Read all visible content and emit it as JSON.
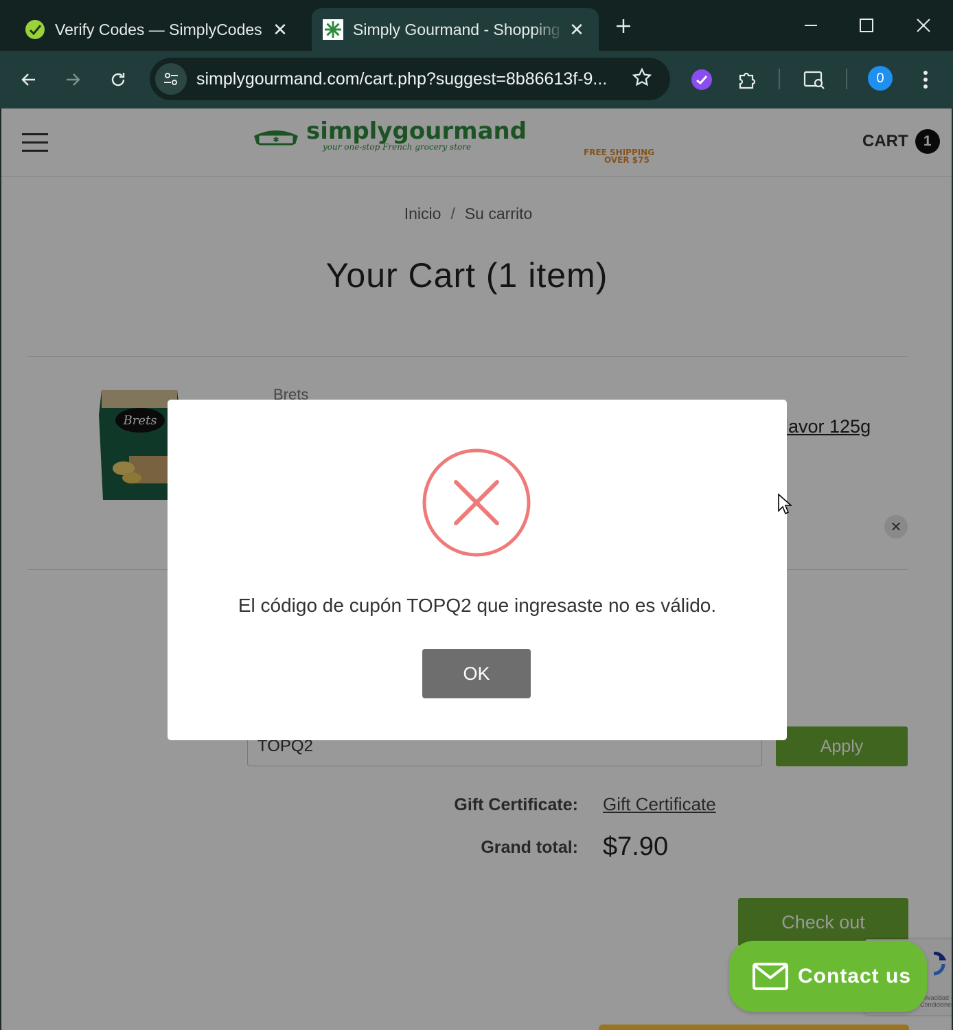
{
  "browser": {
    "tabs": [
      {
        "title": "Verify Codes — SimplyCodes",
        "active": false
      },
      {
        "title": "Simply Gourmand - Shopping Cart",
        "active": true
      }
    ],
    "url": "simplygourmand.com/cart.php?suggest=8b86613f-9...",
    "profile_initial": "0",
    "accent": "#213d3b"
  },
  "header": {
    "logo_text": "simplygourmand",
    "logo_tagline": "your one-stop French grocery store",
    "logo_shipping_1": "FREE SHIPPING",
    "logo_shipping_2": "OVER $75",
    "cart_label": "CART",
    "cart_count": "1"
  },
  "breadcrumb": {
    "home": "Inicio",
    "separator": "/",
    "current": "Su carrito"
  },
  "cart": {
    "title": "Your Cart (1 item)",
    "item": {
      "brand": "Brets",
      "name_visible": "lavor 125g",
      "image_label": "Brets"
    },
    "coupon_value": "TOPQ2",
    "apply_label": "Apply",
    "gift_label": "Gift Certificate:",
    "gift_link": "Gift Certificate",
    "grand_total_label": "Grand total:",
    "grand_total_value": "$7.90",
    "checkout_label": "Check out"
  },
  "modal": {
    "message": "El código de cupón TOPQ2 que ingresaste no es válido.",
    "ok_label": "OK",
    "error_color": "#ee7a7a"
  },
  "contact": {
    "label": "Contact us",
    "color": "#6abb33"
  },
  "recaptcha": {
    "text": "Privacidad - Condiciones"
  }
}
